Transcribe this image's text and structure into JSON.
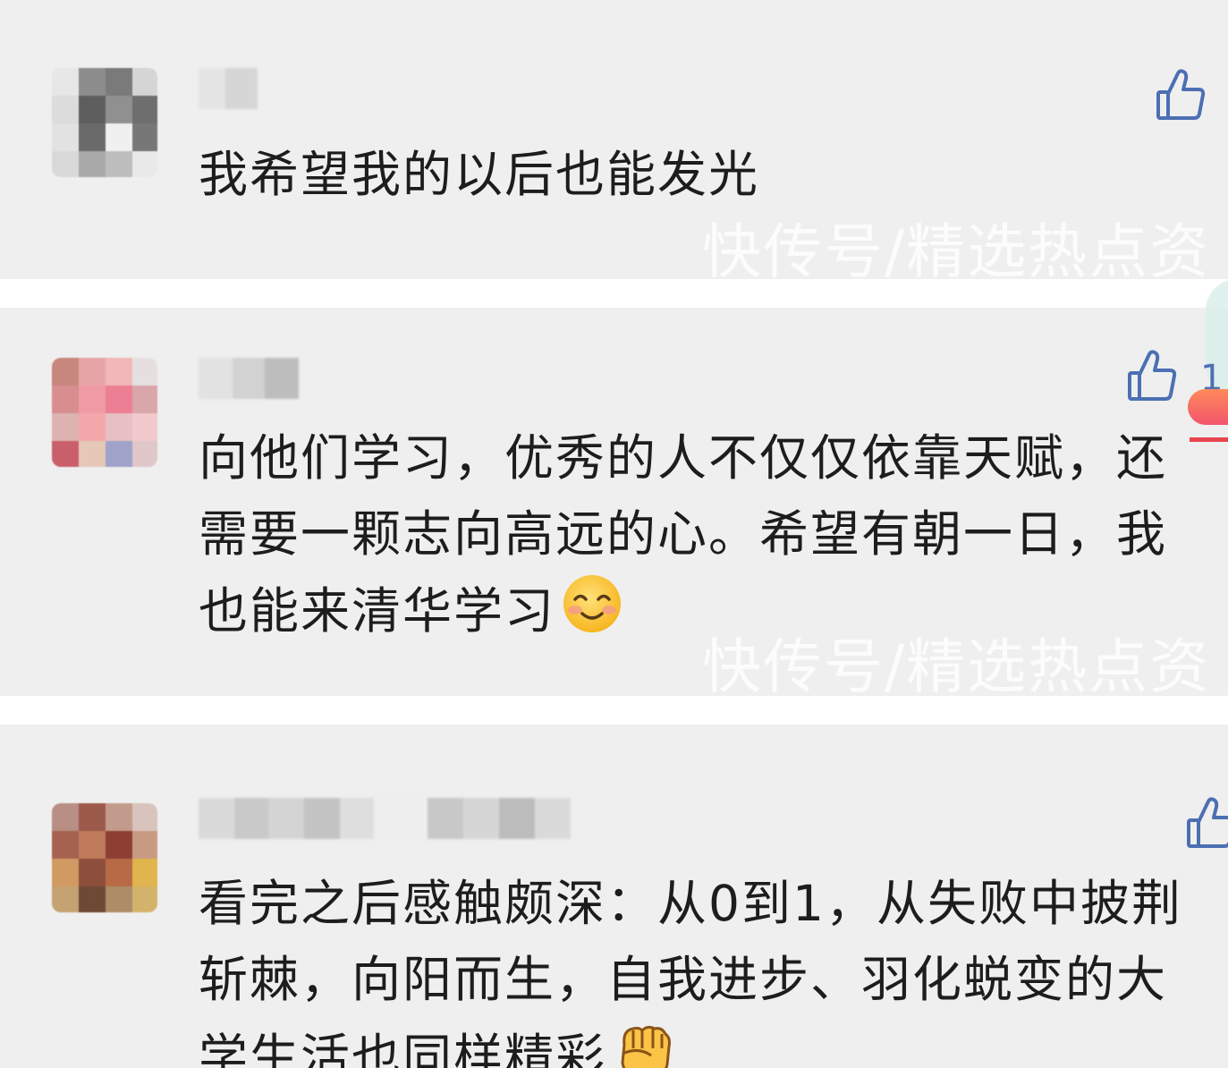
{
  "colors": {
    "background": "#efefef",
    "separator": "#ffffff",
    "text": "#1d1d1d",
    "like_icon": "#4c6fb3",
    "watermark": "#ffffff"
  },
  "watermark_text": "快传号/精选热点资",
  "comments": [
    {
      "text": "我希望我的以后也能发光",
      "like_icon": "thumbs-up-icon"
    },
    {
      "text": "向他们学习，优秀的人不仅仅依靠天赋，还\n需要一颗志向高远的心。希望有朝一日，我\n也能来清华学习",
      "like_icon": "thumbs-up-icon",
      "like_count": "1",
      "emoji": "smiling-face-emoji"
    },
    {
      "text": "看完之后感触颇深：从0到1，从失败中披荆\n斩棘，向阳而生，自我进步、羽化蜕变的大\n学生活也同样精彩",
      "like_icon": "thumbs-up-icon",
      "emoji": "fist-emoji"
    }
  ]
}
